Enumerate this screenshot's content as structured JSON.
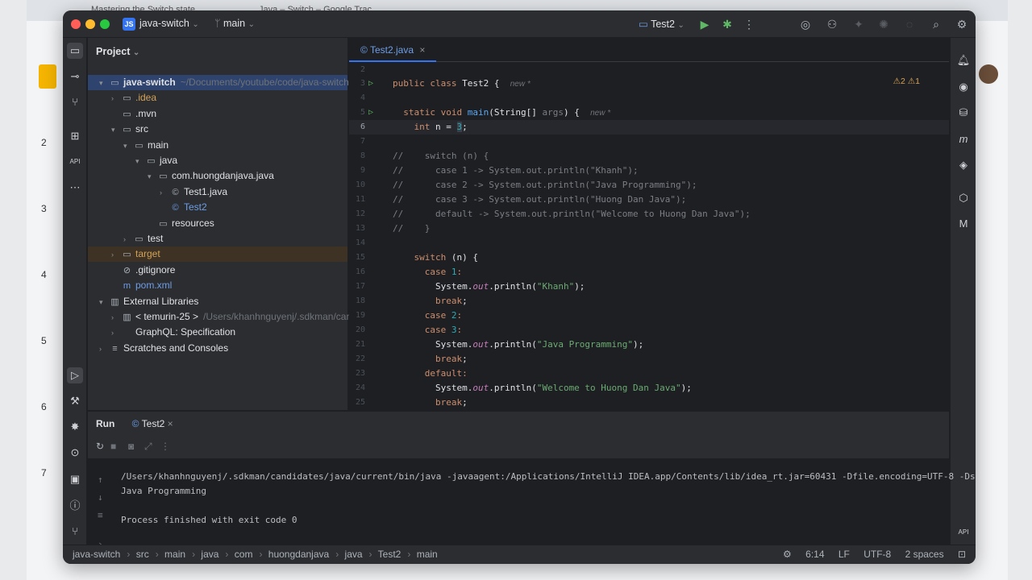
{
  "browser": {
    "tabs": [
      "Mastering the Switch state…",
      "Java – Switch – Google Trac…"
    ],
    "side_numbers": [
      "2",
      "3",
      "4",
      "5",
      "6",
      "7"
    ]
  },
  "titlebar": {
    "project_badge": "JS",
    "project_name": "java-switch",
    "branch": "main",
    "run_config": "Test2"
  },
  "project_panel": {
    "title": "Project",
    "tree": [
      {
        "label": "java-switch",
        "extra": "~/Documents/youtube/code/java-switch",
        "indent": 0,
        "arrow": "▾",
        "icon": "▭",
        "selected": true
      },
      {
        "label": ".idea",
        "indent": 1,
        "arrow": "›",
        "icon": "▭",
        "color": "orange"
      },
      {
        "label": ".mvn",
        "indent": 1,
        "arrow": "",
        "icon": "▭"
      },
      {
        "label": "src",
        "indent": 1,
        "arrow": "▾",
        "icon": "▭"
      },
      {
        "label": "main",
        "indent": 2,
        "arrow": "▾",
        "icon": "▭"
      },
      {
        "label": "java",
        "indent": 3,
        "arrow": "▾",
        "icon": "▭"
      },
      {
        "label": "com.huongdanjava.java",
        "indent": 4,
        "arrow": "▾",
        "icon": "▭"
      },
      {
        "label": "Test1.java",
        "indent": 5,
        "arrow": "›",
        "icon": "©"
      },
      {
        "label": "Test2",
        "indent": 5,
        "arrow": "",
        "icon": "©",
        "color": "blue"
      },
      {
        "label": "resources",
        "indent": 4,
        "arrow": "",
        "icon": "▭"
      },
      {
        "label": "test",
        "indent": 2,
        "arrow": "›",
        "icon": "▭"
      },
      {
        "label": "target",
        "indent": 1,
        "arrow": "›",
        "icon": "▭",
        "color": "orange",
        "excluded": true
      },
      {
        "label": ".gitignore",
        "indent": 1,
        "arrow": "",
        "icon": "⊘"
      },
      {
        "label": "pom.xml",
        "indent": 1,
        "arrow": "",
        "icon": "m",
        "color": "blue"
      },
      {
        "label": "External Libraries",
        "indent": 0,
        "arrow": "▾",
        "icon": "▥"
      },
      {
        "label": "< temurin-25 >",
        "extra": "/Users/khanhnguyenj/.sdkman/candid",
        "indent": 1,
        "arrow": "›",
        "icon": "▥"
      },
      {
        "label": "GraphQL: Specification",
        "indent": 1,
        "arrow": "›",
        "icon": ""
      },
      {
        "label": "Scratches and Consoles",
        "indent": 0,
        "arrow": "›",
        "icon": "≡"
      }
    ]
  },
  "editor": {
    "tab_label": "Test2.java",
    "warnings": "⚠2  ⚠1",
    "hints": {
      "new": "new *"
    },
    "code": {
      "l3_kw": "public class",
      "l3_name": " Test2 {",
      "l5_a": "static void ",
      "l5_fn": "main",
      "l5_b": "(String[] ",
      "l5_args": "args",
      "l5_c": ") {",
      "l6_kw": "int",
      "l6_b": " n = ",
      "l6_num": "3",
      "l6_end": ";",
      "l8": "//    switch (n) {",
      "l9": "//      case 1 -> System.out.println(\"Khanh\");",
      "l10": "//      case 2 -> System.out.println(\"Java Programming\");",
      "l11": "//      case 3 -> System.out.println(\"Huong Dan Java\");",
      "l12": "//      default -> System.out.println(\"Welcome to Huong Dan Java\");",
      "l13": "//    }",
      "switch_kw": "switch",
      "switch_rest": " (n) {",
      "case": "case",
      "one": " 1",
      "two": " 2",
      "three": " 3",
      "colon": ":",
      "sys": "System.",
      "out": "out",
      "println": ".println(",
      "s_khanh": "\"Khanh\"",
      "s_java": "\"Java Programming\"",
      "s_welcome": "\"Welcome to Huong Dan Java\"",
      "close": ");",
      "break": "break",
      "semi": ";",
      "default": "default"
    },
    "line_numbers": [
      "2",
      "3",
      "4",
      "5",
      "6",
      "7",
      "8",
      "9",
      "10",
      "11",
      "12",
      "13",
      "14",
      "15",
      "16",
      "17",
      "18",
      "19",
      "20",
      "21",
      "22",
      "23",
      "24",
      "25"
    ]
  },
  "run_panel": {
    "title": "Run",
    "tab": "Test2",
    "console": [
      "/Users/khanhnguyenj/.sdkman/candidates/java/current/bin/java -javaagent:/Applications/IntelliJ IDEA.app/Contents/lib/idea_rt.jar=60431 -Dfile.encoding=UTF-8 -Dsun.",
      "Java Programming",
      "",
      "Process finished with exit code 0"
    ]
  },
  "statusbar": {
    "crumbs": [
      "java-switch",
      "src",
      "main",
      "java",
      "com",
      "huongdanjava",
      "java",
      "Test2",
      "main"
    ],
    "position": "6:14",
    "line_sep": "LF",
    "encoding": "UTF-8",
    "indent": "2 spaces"
  }
}
